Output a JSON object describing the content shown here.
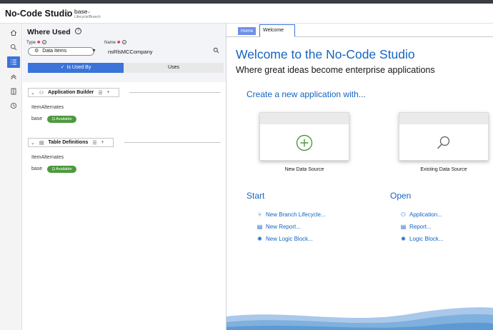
{
  "app": {
    "title": "No-Code Studio",
    "separator": "|",
    "branch": "base",
    "branch_sub": "Lifecycle/Branch"
  },
  "rail": {
    "icons": [
      "home-icon",
      "search-icon",
      "list-icon",
      "pipeline-icon",
      "book-icon",
      "history-icon"
    ],
    "active_index": 2
  },
  "where_used": {
    "title": "Where Used",
    "help": "?",
    "type_label": "Type",
    "name_label": "Name",
    "type_value": "Data Items",
    "name_value": "nsRlsMCCompany",
    "toggle": {
      "is_used_by": "Is Used By",
      "uses": "Uses"
    },
    "groups": [
      {
        "title": "Application Builder",
        "items": [
          {
            "name": "ItemAlternates",
            "branch": "base",
            "status": "Available"
          }
        ]
      },
      {
        "title": "Table Definitions",
        "items": [
          {
            "name": "ItemAlternates",
            "branch": "base",
            "status": "Available"
          }
        ]
      }
    ]
  },
  "tabs": {
    "home": "Home",
    "welcome": "Welcome"
  },
  "welcome": {
    "title": "Welcome to the No-Code Studio",
    "subtitle": "Where great ideas become enterprise applications",
    "create_heading": "Create a new application with...",
    "cards": [
      {
        "label": "New Data Source",
        "icon": "plus-circle-icon"
      },
      {
        "label": "Existing Data Source",
        "icon": "magnifier-icon"
      }
    ],
    "start": {
      "heading": "Start",
      "links": [
        "New Branch Lifecycle...",
        "New Report...",
        "New Logic Block..."
      ]
    },
    "open": {
      "heading": "Open",
      "links": [
        "Application...",
        "Report...",
        "Logic Block..."
      ]
    }
  },
  "colors": {
    "accent": "#3b73d9",
    "link": "#1565c0",
    "available": "#4d9a3e"
  }
}
